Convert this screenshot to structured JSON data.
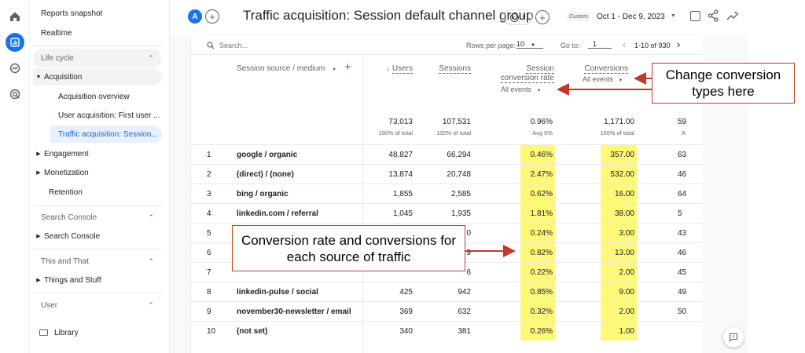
{
  "nav": {
    "reports_snapshot": "Reports snapshot",
    "realtime": "Realtime",
    "lifecycle": "Life cycle",
    "acquisition": "Acquisition",
    "acquisition_overview": "Acquisition overview",
    "user_acquisition": "User acquisition: First user ...",
    "traffic_acquisition": "Traffic acquisition: Session...",
    "engagement": "Engagement",
    "monetization": "Monetization",
    "retention": "Retention",
    "search_console_section": "Search Console",
    "search_console_item": "Search Console",
    "this_and_that": "This and That",
    "things_and_stuff": "Things and Stuff",
    "user_section": "User",
    "library": "Library"
  },
  "header": {
    "avatar_letter": "A",
    "title": "Traffic acquisition: Session default channel group",
    "date_tag": "Custom",
    "date_range": "Oct 1 - Dec 9, 2023"
  },
  "toolbar": {
    "search_placeholder": "Search...",
    "rows_per_page_label": "Rows per page:",
    "rows_per_page_value": "10",
    "goto_label": "Go to:",
    "goto_value": "1",
    "pagination": "1-10 of 930"
  },
  "columns": {
    "dimension": "Session source / medium",
    "users": "Users",
    "sessions": "Sessions",
    "conv_rate_line1": "Session",
    "conv_rate_line2": "conversion rate",
    "conv_rate_filter": "All events",
    "conversions": "Conversions",
    "conversions_filter": "All events"
  },
  "totals": {
    "users": "73,013",
    "users_sub": "100% of total",
    "sessions": "107,531",
    "sessions_sub": "100% of total",
    "rate": "0.96%",
    "rate_sub": "Avg 0%",
    "conversions": "1,171.00",
    "conversions_sub": "100% of total",
    "next": "59",
    "next_sub": "A"
  },
  "rows": [
    {
      "n": "1",
      "source": "google / organic",
      "users": "48,827",
      "sessions": "66,294",
      "rate": "0.46%",
      "conv": "357.00",
      "next": "63"
    },
    {
      "n": "2",
      "source": "(direct) / (none)",
      "users": "13,874",
      "sessions": "20,748",
      "rate": "2.47%",
      "conv": "532.00",
      "next": "46"
    },
    {
      "n": "3",
      "source": "bing / organic",
      "users": "1,855",
      "sessions": "2,585",
      "rate": "0.62%",
      "conv": "16.00",
      "next": "64"
    },
    {
      "n": "4",
      "source": "linkedin.com / referral",
      "users": "1,045",
      "sessions": "1,935",
      "rate": "1.81%",
      "conv": "38.00",
      "next": "5"
    },
    {
      "n": "5",
      "source": "",
      "users": "",
      "sessions": "0",
      "rate": "0.24%",
      "conv": "3.00",
      "next": "43"
    },
    {
      "n": "6",
      "source": "",
      "users": "",
      "sessions": "9",
      "rate": "0.82%",
      "conv": "13.00",
      "next": "46"
    },
    {
      "n": "7",
      "source": "",
      "users": "",
      "sessions": "6",
      "rate": "0.22%",
      "conv": "2.00",
      "next": "45"
    },
    {
      "n": "8",
      "source": "linkedin-pulse / social",
      "users": "425",
      "sessions": "942",
      "rate": "0.85%",
      "conv": "9.00",
      "next": "49"
    },
    {
      "n": "9",
      "source": "november30-newsletter / email",
      "users": "369",
      "sessions": "632",
      "rate": "0.32%",
      "conv": "2.00",
      "next": "50"
    },
    {
      "n": "10",
      "source": "(not set)",
      "users": "340",
      "sessions": "381",
      "rate": "0.26%",
      "conv": "1.00",
      "next": ""
    }
  ],
  "callouts": {
    "conversion_types": "Change conversion types here",
    "conversion_rates": "Conversion rate and conversions for each source of traffic"
  },
  "colors": {
    "accent": "#1a73e8",
    "highlight": "#fdf77a",
    "callout_border": "#b74327",
    "arrow": "#c0392b"
  }
}
